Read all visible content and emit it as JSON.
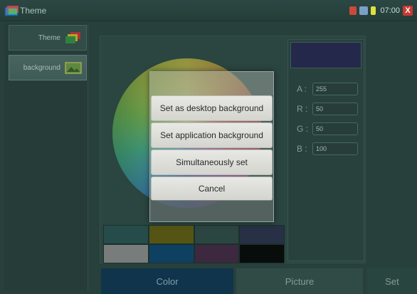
{
  "app": {
    "title": "Theme",
    "time": "07:00",
    "close_glyph": "X"
  },
  "sidebar": {
    "items": [
      {
        "label": "Theme",
        "icon": "layers-icon"
      },
      {
        "label": "background",
        "icon": "image-icon"
      }
    ]
  },
  "color_fields": {
    "a": {
      "label": "A :",
      "value": "255"
    },
    "r": {
      "label": "R :",
      "value": "50"
    },
    "g": {
      "label": "G :",
      "value": "50"
    },
    "b": {
      "label": "B :",
      "value": "100"
    }
  },
  "preview_color": "#2a2a5a",
  "swatches": [
    "#2b5a58",
    "#6a6612",
    "#33504d",
    "#2e3550",
    "#9a9a9a",
    "#0d4a78",
    "#4a2a4a",
    "#050505"
  ],
  "bottom_tabs": {
    "color": "Color",
    "picture": "Picture",
    "set": "Set"
  },
  "dialog": {
    "options": [
      "Set as desktop background",
      "Set application background",
      "Simultaneously set",
      "Cancel"
    ]
  }
}
